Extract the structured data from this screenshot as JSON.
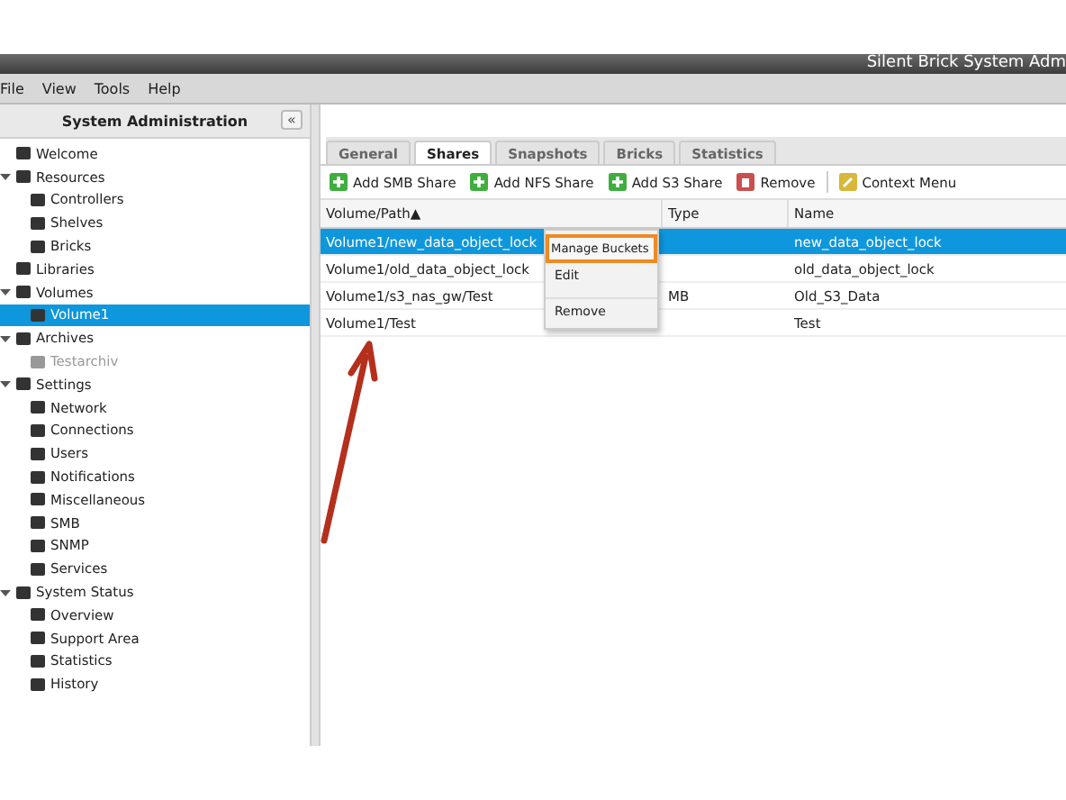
{
  "window": {
    "title": "Silent Brick System Adm"
  },
  "menu": [
    "File",
    "View",
    "Tools",
    "Help"
  ],
  "sidebar": {
    "title": "System Administration",
    "collapse": "«",
    "items": [
      {
        "label": "Welcome",
        "expanded": false,
        "selected": false,
        "disabled": false
      },
      {
        "label": "Resources",
        "expanded": true,
        "selected": false,
        "disabled": false,
        "children": [
          {
            "label": "Controllers",
            "selected": false,
            "disabled": false
          },
          {
            "label": "Shelves",
            "selected": false,
            "disabled": false
          },
          {
            "label": "Bricks",
            "selected": false,
            "disabled": false
          }
        ]
      },
      {
        "label": "Libraries",
        "expanded": false,
        "selected": false,
        "disabled": false
      },
      {
        "label": "Volumes",
        "expanded": true,
        "selected": false,
        "disabled": false,
        "children": [
          {
            "label": "Volume1",
            "selected": true,
            "disabled": false
          }
        ]
      },
      {
        "label": "Archives",
        "expanded": true,
        "selected": false,
        "disabled": false,
        "children": [
          {
            "label": "Testarchiv",
            "selected": false,
            "disabled": true
          }
        ]
      },
      {
        "label": "Settings",
        "expanded": true,
        "selected": false,
        "disabled": false,
        "children": [
          {
            "label": "Network",
            "selected": false,
            "disabled": false
          },
          {
            "label": "Connections",
            "selected": false,
            "disabled": false
          },
          {
            "label": "Users",
            "selected": false,
            "disabled": false
          },
          {
            "label": "Notifications",
            "selected": false,
            "disabled": false
          },
          {
            "label": "Miscellaneous",
            "selected": false,
            "disabled": false
          },
          {
            "label": "SMB",
            "selected": false,
            "disabled": false
          },
          {
            "label": "SNMP",
            "selected": false,
            "disabled": false
          },
          {
            "label": "Services",
            "selected": false,
            "disabled": false
          }
        ]
      },
      {
        "label": "System Status",
        "expanded": true,
        "selected": false,
        "disabled": false,
        "children": [
          {
            "label": "Overview",
            "selected": false,
            "disabled": false
          },
          {
            "label": "Support Area",
            "selected": false,
            "disabled": false
          },
          {
            "label": "Statistics",
            "selected": false,
            "disabled": false
          },
          {
            "label": "History",
            "selected": false,
            "disabled": false
          }
        ]
      }
    ]
  },
  "tabs": [
    {
      "label": "General",
      "selected": false
    },
    {
      "label": "Shares",
      "selected": true
    },
    {
      "label": "Snapshots",
      "selected": false
    },
    {
      "label": "Bricks",
      "selected": false
    },
    {
      "label": "Statistics",
      "selected": false
    }
  ],
  "toolbar": [
    {
      "label": "Add SMB Share",
      "kind": "add"
    },
    {
      "label": "Add NFS Share",
      "kind": "add"
    },
    {
      "label": "Add S3 Share",
      "kind": "add"
    },
    {
      "label": "Remove",
      "kind": "remove"
    },
    {
      "label": "Context Menu",
      "kind": "edit"
    }
  ],
  "table": {
    "columns": [
      {
        "label": "Volume/Path",
        "sort": "▲"
      },
      {
        "label": "Type"
      },
      {
        "label": "Name"
      }
    ],
    "rows": [
      {
        "path": "Volume1/new_data_object_lock",
        "name": "new_data_object_lock",
        "selected": true
      },
      {
        "path": "Volume1/old_data_object_lock",
        "name": "old_data_object_lock",
        "selected": false
      },
      {
        "path": "Volume1/s3_nas_gw/Test",
        "type": "MB",
        "name": "Old_S3_Data",
        "selected": false
      },
      {
        "path": "Volume1/Test",
        "name": "Test",
        "selected": false
      }
    ]
  },
  "context_menu": [
    {
      "label": "Manage Buckets",
      "highlighted": true
    },
    {
      "label": "Edit",
      "highlighted": false
    },
    {
      "label": "Remove",
      "highlighted": false
    }
  ]
}
